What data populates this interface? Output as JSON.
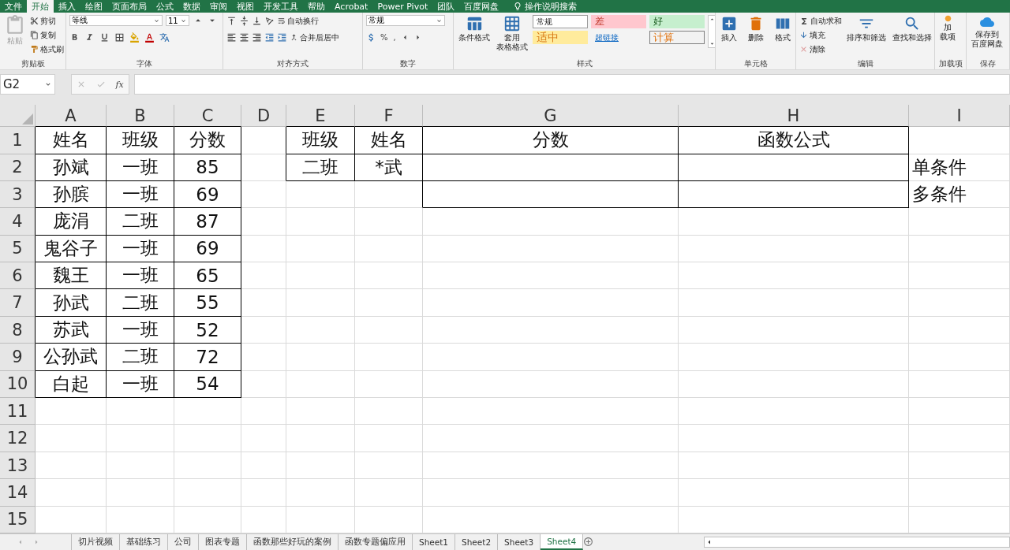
{
  "menu_tabs": [
    {
      "label": "文件",
      "selected": false
    },
    {
      "label": "开始",
      "selected": true
    },
    {
      "label": "插入",
      "selected": false
    },
    {
      "label": "绘图",
      "selected": false
    },
    {
      "label": "页面布局",
      "selected": false
    },
    {
      "label": "公式",
      "selected": false
    },
    {
      "label": "数据",
      "selected": false
    },
    {
      "label": "审阅",
      "selected": false
    },
    {
      "label": "视图",
      "selected": false
    },
    {
      "label": "开发工具",
      "selected": false
    },
    {
      "label": "帮助",
      "selected": false
    },
    {
      "label": "Acrobat",
      "selected": false
    },
    {
      "label": "Power Pivot",
      "selected": false
    },
    {
      "label": "团队",
      "selected": false
    },
    {
      "label": "百度网盘",
      "selected": false
    }
  ],
  "tell_me": {
    "label": "操作说明搜索"
  },
  "ribbon": {
    "clipboard": {
      "paste": {
        "label": "粘贴",
        "disabled": true
      },
      "cut": "剪切",
      "copy": "复制",
      "format_painter": "格式刷",
      "label": "剪贴板"
    },
    "font": {
      "font_name": "等线",
      "font_size": "11",
      "label": "字体"
    },
    "alignment": {
      "wrap_text": "自动换行",
      "merge_center": "合并后居中",
      "label": "对齐方式"
    },
    "number": {
      "format": "常规",
      "percent": "%",
      "comma": ",",
      "label": "数字"
    },
    "styles": {
      "conditional_format": "条件格式",
      "format_as_table": [
        "套用",
        "表格格式"
      ],
      "gallery": [
        {
          "label": "常规",
          "kind": "normal"
        },
        {
          "label": "差",
          "kind": "bad"
        },
        {
          "label": "好",
          "kind": "good"
        },
        {
          "label": "适中",
          "kind": "neutral"
        },
        {
          "label": "超链接",
          "kind": "hyperlink"
        },
        {
          "label": "计算",
          "kind": "calculation"
        }
      ],
      "label": "样式"
    },
    "cells": {
      "buttons": [
        "插入",
        "删除",
        "格式"
      ],
      "label": "单元格"
    },
    "editing": {
      "autosum": "自动求和",
      "fill": "填充",
      "clear": "清除",
      "sort_filter": "排序和筛选",
      "find_select": "查找和选择",
      "label": "编辑"
    },
    "addins": {
      "button": [
        "加",
        "载项"
      ],
      "label": "加载项"
    },
    "save": {
      "button": [
        "保存到",
        "百度网盘"
      ],
      "label": "保存"
    }
  },
  "formula_bar": {
    "name_box": "G2",
    "fx": "fx"
  },
  "sheet": {
    "columns": [
      "A",
      "B",
      "C",
      "D",
      "E",
      "F",
      "G",
      "H",
      "I"
    ],
    "rows": [
      {
        "header": "1",
        "cells": {
          "A": {
            "text": "姓名",
            "bordered": true
          },
          "B": {
            "text": "班级",
            "bordered": true
          },
          "C": {
            "text": "分数",
            "bordered": true
          },
          "E": {
            "text": "班级",
            "bordered": true
          },
          "F": {
            "text": "姓名",
            "bordered": true
          },
          "G": {
            "text": "分数",
            "bordered": true
          },
          "H": {
            "text": "函数公式",
            "bordered": true
          }
        }
      },
      {
        "header": "2",
        "cells": {
          "A": {
            "text": "孙斌",
            "bordered": true
          },
          "B": {
            "text": "一班",
            "bordered": true
          },
          "C": {
            "text": "85",
            "bordered": true
          },
          "E": {
            "text": "二班",
            "bordered": true
          },
          "F": {
            "text": "*武",
            "bordered": true
          },
          "G": {
            "bordered": true
          },
          "H": {
            "bordered": true
          },
          "I": {
            "text": "单条件",
            "bordered": false
          }
        }
      },
      {
        "header": "3",
        "cells": {
          "A": {
            "text": "孙膑",
            "bordered": true
          },
          "B": {
            "text": "一班",
            "bordered": true
          },
          "C": {
            "text": "69",
            "bordered": true
          },
          "G": {
            "bordered": true
          },
          "H": {
            "bordered": true
          },
          "I": {
            "text": "多条件",
            "bordered": false
          }
        }
      },
      {
        "header": "4",
        "cells": {
          "A": {
            "text": "庞涓",
            "bordered": true
          },
          "B": {
            "text": "二班",
            "bordered": true
          },
          "C": {
            "text": "87",
            "bordered": true
          }
        }
      },
      {
        "header": "5",
        "cells": {
          "A": {
            "text": "鬼谷子",
            "bordered": true
          },
          "B": {
            "text": "一班",
            "bordered": true
          },
          "C": {
            "text": "69",
            "bordered": true
          }
        }
      },
      {
        "header": "6",
        "cells": {
          "A": {
            "text": "魏王",
            "bordered": true
          },
          "B": {
            "text": "一班",
            "bordered": true
          },
          "C": {
            "text": "65",
            "bordered": true
          }
        }
      },
      {
        "header": "7",
        "cells": {
          "A": {
            "text": "孙武",
            "bordered": true
          },
          "B": {
            "text": "二班",
            "bordered": true
          },
          "C": {
            "text": "55",
            "bordered": true
          }
        }
      },
      {
        "header": "8",
        "cells": {
          "A": {
            "text": "苏武",
            "bordered": true
          },
          "B": {
            "text": "一班",
            "bordered": true
          },
          "C": {
            "text": "52",
            "bordered": true
          }
        }
      },
      {
        "header": "9",
        "cells": {
          "A": {
            "text": "公孙武",
            "bordered": true
          },
          "B": {
            "text": "二班",
            "bordered": true
          },
          "C": {
            "text": "72",
            "bordered": true
          }
        }
      },
      {
        "header": "10",
        "cells": {
          "A": {
            "text": "白起",
            "bordered": true
          },
          "B": {
            "text": "一班",
            "bordered": true
          },
          "C": {
            "text": "54",
            "bordered": true
          }
        }
      },
      {
        "header": "11"
      },
      {
        "header": "12"
      },
      {
        "header": "13"
      },
      {
        "header": "14"
      },
      {
        "header": "15"
      }
    ]
  },
  "sheet_tabs": [
    {
      "label": "切片视频",
      "selected": false
    },
    {
      "label": "基础练习",
      "selected": false
    },
    {
      "label": "公司",
      "selected": false
    },
    {
      "label": "图表专题",
      "selected": false
    },
    {
      "label": "函数那些好玩的案例",
      "selected": false
    },
    {
      "label": "函数专题偏应用",
      "selected": false
    },
    {
      "label": "Sheet1",
      "selected": false
    },
    {
      "label": "Sheet2",
      "selected": false
    },
    {
      "label": "Sheet3",
      "selected": false
    },
    {
      "label": "Sheet4",
      "selected": true
    }
  ]
}
